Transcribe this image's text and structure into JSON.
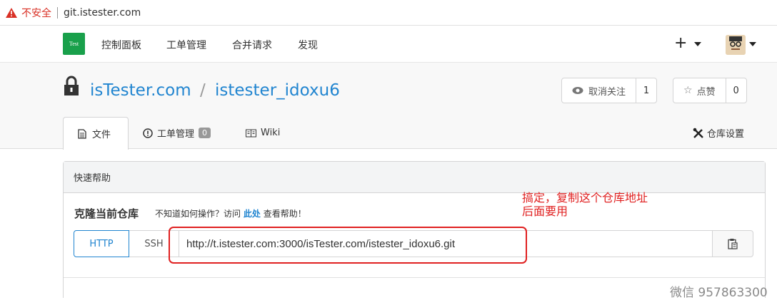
{
  "browser": {
    "insecure_label": "不安全",
    "url": "git.istester.com"
  },
  "logo": {
    "text": "Test"
  },
  "nav": {
    "items": [
      "控制面板",
      "工单管理",
      "合并请求",
      "发现"
    ],
    "plus": "+"
  },
  "repo": {
    "owner": "isTester.com",
    "separator": "/",
    "name": "istester_idoxu6",
    "watch": {
      "label": "取消关注",
      "count": "1"
    },
    "star": {
      "label": "点赞",
      "count": "0"
    }
  },
  "tabs": {
    "files": "文件",
    "issues": "工单管理",
    "issues_count": "0",
    "wiki": "Wiki",
    "settings": "仓库设置"
  },
  "quick_help": {
    "header": "快速帮助",
    "clone_title": "克隆当前仓库",
    "hint_prefix": "不知道如何操作？访问",
    "hint_link": "此处",
    "hint_suffix": "查看帮助！",
    "http_label": "HTTP",
    "ssh_label": "SSH",
    "clone_url": "http://t.istester.com:3000/isTester.com/istester_idoxu6.git"
  },
  "annotation": {
    "line1": "搞定，复制这个仓库地址",
    "line2": "后面要用",
    "color": "#e02020"
  },
  "watermark": "微信 957863300",
  "colors": {
    "link": "#2185d0",
    "logo": "#19a04b"
  }
}
